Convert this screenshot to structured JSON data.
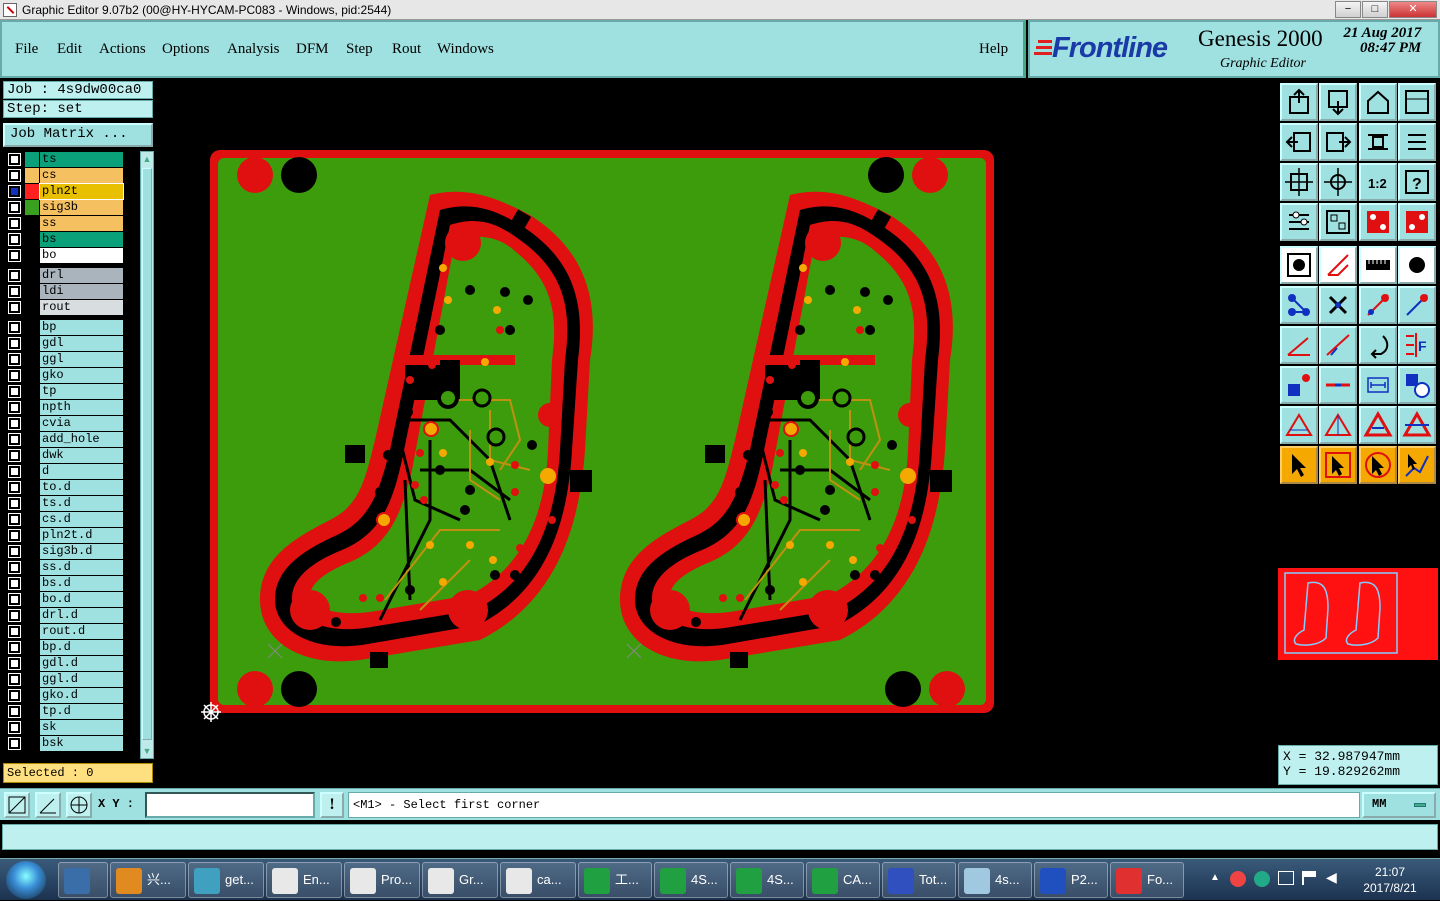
{
  "window": {
    "title": "Graphic Editor 9.07b2 (00@HY-HYCAM-PC083 - Windows, pid:2544)",
    "min": "−",
    "max": "□",
    "close": "✕"
  },
  "menu": [
    {
      "label": "File"
    },
    {
      "label": "Edit"
    },
    {
      "label": "Actions"
    },
    {
      "label": "Options"
    },
    {
      "label": "Analysis"
    },
    {
      "label": "DFM"
    },
    {
      "label": "Step"
    },
    {
      "label": "Rout"
    },
    {
      "label": "Windows"
    }
  ],
  "help": "Help",
  "brand": {
    "logo": "Frontline",
    "product": "Genesis 2000",
    "subtitle": "Graphic Editor",
    "date": "21 Aug 2017",
    "time": "08:47 PM"
  },
  "job": {
    "job": "Job : 4s9dw00ca0",
    "step": "Step: set",
    "matrix": "Job Matrix ..."
  },
  "layers": [
    {
      "name": "ts",
      "color": "#0aa07a",
      "bg": "#0aa07a",
      "mark": ""
    },
    {
      "name": "cs",
      "color": "#f5c060",
      "bg": "#f5c060",
      "mark": ""
    },
    {
      "name": "pln2t",
      "color": "#ff2020",
      "bg": "#e8c000",
      "mark": "▤",
      "active": true
    },
    {
      "name": "sig3b",
      "color": "#3aa020",
      "bg": "#f5c060",
      "mark": ""
    },
    {
      "name": "ss",
      "color": "#000000",
      "bg": "#f5c060",
      "mark": ""
    },
    {
      "name": "bs",
      "color": "#000000",
      "bg": "#0aa07a",
      "mark": ""
    },
    {
      "name": "bo",
      "color": "#000000",
      "bg": "#ffffff",
      "mark": ""
    },
    {
      "name": "drl",
      "color": "#000000",
      "bg": "#aab4bc",
      "mark": "",
      "gap": true
    },
    {
      "name": "ldi",
      "color": "#000000",
      "bg": "#aab4bc",
      "mark": ""
    },
    {
      "name": "rout",
      "color": "#000000",
      "bg": "#d8dde0",
      "mark": ""
    },
    {
      "name": "bp",
      "color": "#000000",
      "bg": "#9fe0e0",
      "mark": "",
      "gap": true
    },
    {
      "name": "gdl",
      "color": "#000000",
      "bg": "#9fe0e0",
      "mark": ""
    },
    {
      "name": "ggl",
      "color": "#000000",
      "bg": "#9fe0e0",
      "mark": ""
    },
    {
      "name": "gko",
      "color": "#000000",
      "bg": "#9fe0e0",
      "mark": ""
    },
    {
      "name": "tp",
      "color": "#000000",
      "bg": "#9fe0e0",
      "mark": ""
    },
    {
      "name": "npth",
      "color": "#000000",
      "bg": "#9fe0e0",
      "mark": ""
    },
    {
      "name": "cvia",
      "color": "#000000",
      "bg": "#9fe0e0",
      "mark": ""
    },
    {
      "name": "add_hole",
      "color": "#000000",
      "bg": "#9fe0e0",
      "mark": ""
    },
    {
      "name": "dwk",
      "color": "#000000",
      "bg": "#9fe0e0",
      "mark": ""
    },
    {
      "name": "d",
      "color": "#000000",
      "bg": "#9fe0e0",
      "mark": ""
    },
    {
      "name": "to.d",
      "color": "#000000",
      "bg": "#9fe0e0",
      "mark": "↗"
    },
    {
      "name": "ts.d",
      "color": "#000000",
      "bg": "#9fe0e0",
      "mark": ""
    },
    {
      "name": "cs.d",
      "color": "#000000",
      "bg": "#9fe0e0",
      "mark": ""
    },
    {
      "name": "pln2t.d",
      "color": "#000000",
      "bg": "#9fe0e0",
      "mark": ""
    },
    {
      "name": "sig3b.d",
      "color": "#000000",
      "bg": "#9fe0e0",
      "mark": "↗"
    },
    {
      "name": "ss.d",
      "color": "#000000",
      "bg": "#9fe0e0",
      "mark": "↗"
    },
    {
      "name": "bs.d",
      "color": "#000000",
      "bg": "#9fe0e0",
      "mark": ""
    },
    {
      "name": "bo.d",
      "color": "#000000",
      "bg": "#9fe0e0",
      "mark": ""
    },
    {
      "name": "drl.d",
      "color": "#000000",
      "bg": "#9fe0e0",
      "mark": ""
    },
    {
      "name": "rout.d",
      "color": "#000000",
      "bg": "#9fe0e0",
      "mark": ""
    },
    {
      "name": "bp.d",
      "color": "#000000",
      "bg": "#9fe0e0",
      "mark": ""
    },
    {
      "name": "gdl.d",
      "color": "#000000",
      "bg": "#9fe0e0",
      "mark": "↗"
    },
    {
      "name": "ggl.d",
      "color": "#000000",
      "bg": "#9fe0e0",
      "mark": ""
    },
    {
      "name": "gko.d",
      "color": "#000000",
      "bg": "#9fe0e0",
      "mark": "↗"
    },
    {
      "name": "tp.d",
      "color": "#000000",
      "bg": "#9fe0e0",
      "mark": ""
    },
    {
      "name": "sk",
      "color": "#000000",
      "bg": "#9fe0e0",
      "mark": ""
    },
    {
      "name": "bsk",
      "color": "#000000",
      "bg": "#9fe0e0",
      "mark": ""
    }
  ],
  "selected": "Selected : 0",
  "coords": {
    "x": "X = 32.987947mm",
    "y": "Y = 19.829262mm"
  },
  "cmd": {
    "xy_label": "X Y :",
    "xy_value": "",
    "bang": "!",
    "prompt": "<M1> - Select first corner",
    "units": "MM"
  },
  "tools": [
    "zoom-home-icon",
    "zoom-page-icon",
    "home-icon",
    "window-icon",
    "pan-left-icon",
    "pan-right-icon",
    "undo-view-icon",
    "redraw-icon",
    "fit-icon",
    "center-icon",
    "scale-1-2-icon",
    "help-icon",
    "settings-icon",
    "grid-icon",
    "layers-red-icon",
    "layers-red2-icon",
    "pad-icon",
    "line-edit-icon",
    "ruler-icon",
    "dot-icon",
    "connect-icon",
    "cross-icon",
    "snap-icon",
    "snap2-icon",
    "angle-icon",
    "slash-icon",
    "rotate-icon",
    "mirror-icon",
    "move-icon",
    "measure-icon",
    "dimension-icon",
    "shapes-icon",
    "triangle1-icon",
    "triangle2-icon",
    "triangle3-icon",
    "triangle4-icon",
    "pointer-icon",
    "pointer-select-icon",
    "pointer-area-icon",
    "pointer-path-icon"
  ],
  "taskbar": [
    {
      "label": "",
      "color": "#3a6ea8"
    },
    {
      "label": "兴...",
      "color": "#e08a20"
    },
    {
      "label": "get...",
      "color": "#40a0c0"
    },
    {
      "label": "En...",
      "color": "#e8e8e8"
    },
    {
      "label": "Pro...",
      "color": "#e8e8e8"
    },
    {
      "label": "Gr...",
      "color": "#e8e8e8"
    },
    {
      "label": "ca...",
      "color": "#e8e8e8"
    },
    {
      "label": "工...",
      "color": "#20a040"
    },
    {
      "label": "4S...",
      "color": "#20a040"
    },
    {
      "label": "4S...",
      "color": "#20a040"
    },
    {
      "label": "CA...",
      "color": "#20a040"
    },
    {
      "label": "Tot...",
      "color": "#3050c0"
    },
    {
      "label": "4s...",
      "color": "#a0c8e0"
    },
    {
      "label": "P2...",
      "color": "#2050c0"
    },
    {
      "label": "Fo...",
      "color": "#e03030"
    }
  ],
  "clock": {
    "time": "21:07",
    "date": "2017/8/21"
  }
}
